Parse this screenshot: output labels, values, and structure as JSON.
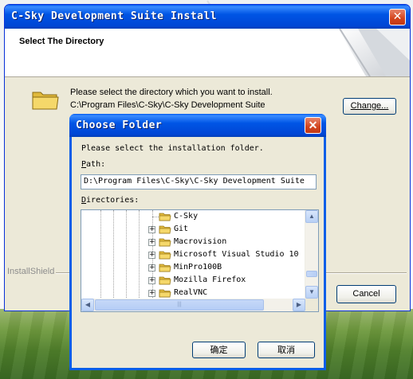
{
  "installer": {
    "title": "C-Sky Development Suite Install",
    "close_glyph": "✕",
    "header_title": "Select The Directory",
    "prompt": "Please select the directory which you want to install.",
    "current_path": "C:\\Program Files\\C-Sky\\C-Sky Development Suite",
    "change_button": "Change...",
    "brand_label": "InstallShield",
    "cancel_button": "Cancel"
  },
  "choose_folder": {
    "title": "Choose Folder",
    "close_glyph": "✕",
    "instruction": "Please select the installation folder.",
    "path_label_accel": "P",
    "path_label_rest": "ath:",
    "path_value": "D:\\Program Files\\C-Sky\\C-Sky Development Suite",
    "directories_label_accel": "D",
    "directories_label_rest": "irectories:",
    "tree_items": [
      {
        "label": "C-Sky",
        "expandable": false,
        "expander": ""
      },
      {
        "label": "Git",
        "expandable": true,
        "expander": "+"
      },
      {
        "label": "Macrovision",
        "expandable": true,
        "expander": "+"
      },
      {
        "label": "Microsoft Visual Studio 10",
        "expandable": true,
        "expander": "+"
      },
      {
        "label": "MinPro100B",
        "expandable": true,
        "expander": "+"
      },
      {
        "label": "Mozilla Firefox",
        "expandable": true,
        "expander": "+"
      },
      {
        "label": "RealVNC",
        "expandable": true,
        "expander": "+"
      }
    ],
    "scroll_up": "▲",
    "scroll_down": "▼",
    "scroll_left": "◀",
    "scroll_right": "▶",
    "hthumb_grip": "|||",
    "ok_button": "确定",
    "cancel_button": "取消"
  },
  "colors": {
    "titlebar_blue": "#0046d5",
    "window_face": "#ece9d8",
    "close_red": "#d2431c",
    "folder_yellow": "#f5d86a"
  }
}
